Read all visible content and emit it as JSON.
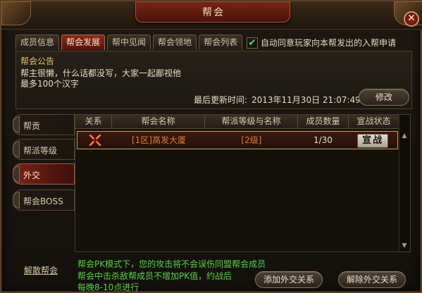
{
  "window": {
    "title": "帮会"
  },
  "tabs": [
    "成员信息",
    "帮会发展",
    "帮中见闻",
    "帮会领地",
    "帮会列表"
  ],
  "auto_accept": {
    "checked": true,
    "label": "自动同意玩家向本帮发出的入帮申请"
  },
  "notice": {
    "title": "帮会公告",
    "lines": [
      "帮主很懒，什么话都没写，大家一起鄙视他",
      "最多100个汉字"
    ],
    "last_update_label": "最后更新时间:",
    "last_update_time": "2013年11月30日 21:07:49",
    "edit_button": "修改"
  },
  "side_tabs": [
    "帮贡",
    "帮派等级",
    "外交",
    "帮会BOSS"
  ],
  "table": {
    "headers": [
      "关系",
      "帮会名称",
      "帮派等级与名称",
      "成员数量",
      "宣战状态"
    ],
    "rows": [
      {
        "relation_icon": "crossed-swords-icon",
        "name": "[1区]高发大厦",
        "level": "[2级]",
        "members": "1/30",
        "status_button": "宣战"
      }
    ]
  },
  "info_lines": [
    "帮会PK模式下，您的攻击将不会误伤同盟帮会成员",
    "帮会中击杀敌帮成员不增加PK值，约战后",
    "每晚8-10点进行"
  ],
  "dissolve_link": "解散帮会",
  "buttons": {
    "add": "添加外交关系",
    "remove": "解除外交关系"
  },
  "colors": {
    "accent_red": "#7a2218",
    "info_green": "#58d046",
    "row_text": "#e07a38"
  }
}
